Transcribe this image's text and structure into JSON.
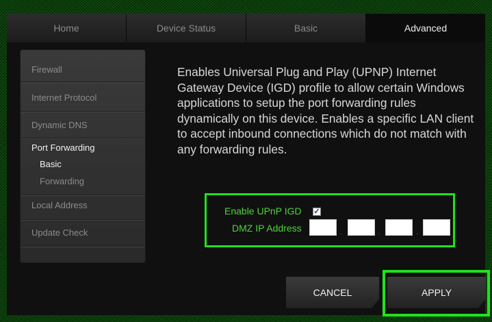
{
  "tabs": [
    "Home",
    "Device Status",
    "Basic",
    "Advanced"
  ],
  "sidebar": {
    "items": [
      "Firewall",
      "Internet Protocol",
      "Dynamic DNS",
      "Port Forwarding",
      "Local Address",
      "Update Check"
    ],
    "sub_items": [
      "Basic",
      "Forwarding"
    ]
  },
  "description": "Enables Universal Plug and Play (UPNP) Internet Gateway Device (IGD) profile to allow certain Windows applications to setup the port forwarding rules dynamically on this device. Enables a specific LAN client to accept inbound connections which do not match with any forwarding rules.",
  "form": {
    "upnp_label": "Enable UPnP IGD",
    "upnp_checked": true,
    "dmz_label": "DMZ IP Address",
    "dmz_ip": [
      "",
      "",
      "",
      ""
    ]
  },
  "buttons": {
    "cancel": "CANCEL",
    "apply": "APPLY"
  },
  "colors": {
    "highlight": "#22e11e",
    "label_green": "#4fd43a"
  }
}
